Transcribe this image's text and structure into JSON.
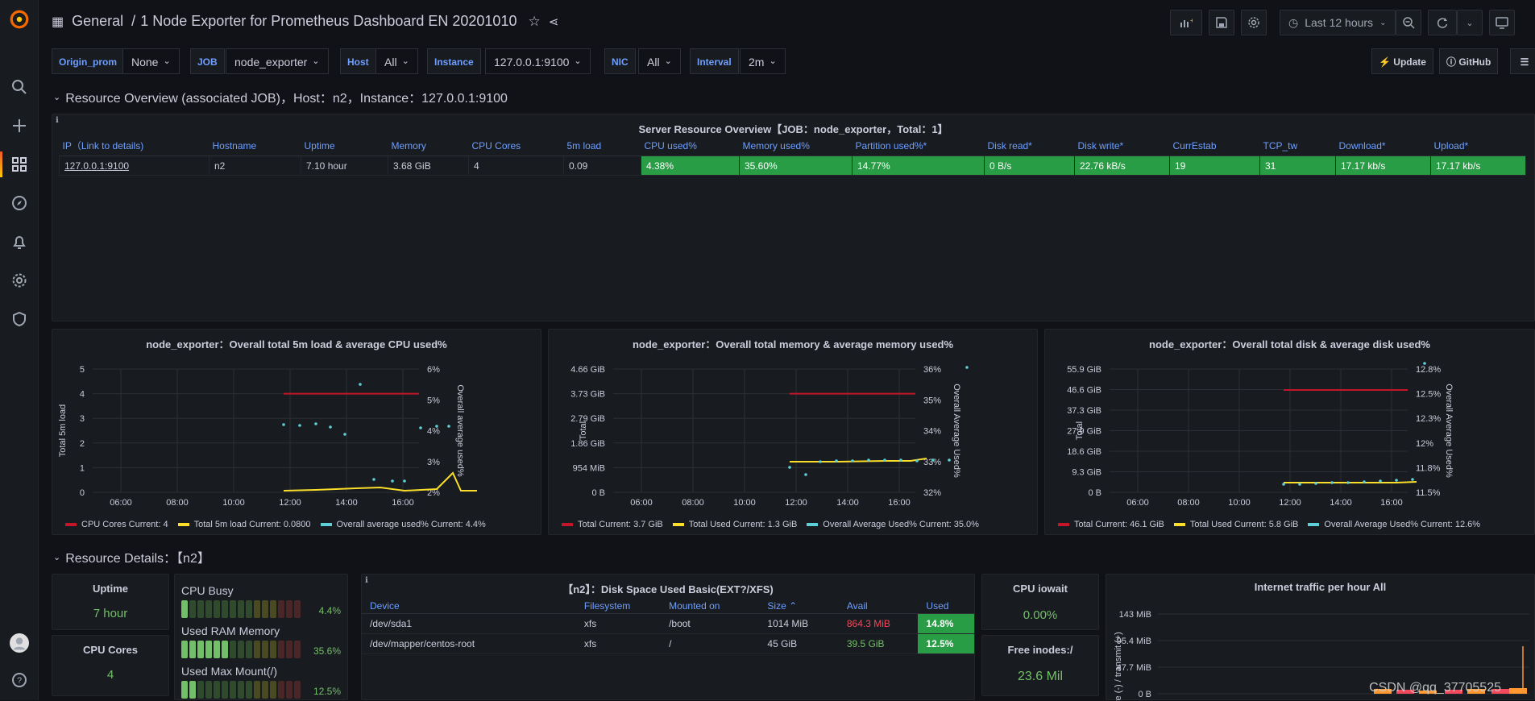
{
  "colors": {
    "accent": "#6e9fff",
    "green": "#73bf69",
    "cell_green": "#299c46",
    "red": "#c4162a",
    "yellow": "#fade2a",
    "cyan": "#5ecfd6",
    "orange_red": "#f2495c"
  },
  "header": {
    "folder": "General",
    "separator": "/",
    "title": "1 Node Exporter for Prometheus Dashboard EN 20201010",
    "time_range": "Last 12 hours"
  },
  "variables": [
    {
      "label": "Origin_prom",
      "value": "None"
    },
    {
      "label": "JOB",
      "value": "node_exporter"
    },
    {
      "label": "Host",
      "value": "All"
    },
    {
      "label": "Instance",
      "value": "127.0.0.1:9100"
    },
    {
      "label": "NIC",
      "value": "All"
    },
    {
      "label": "Interval",
      "value": "2m"
    }
  ],
  "links": {
    "update": "Update",
    "github": "GitHub"
  },
  "row1": {
    "title": "Resource Overview (associated JOB)，Host：n2，Instance：127.0.0.1:9100"
  },
  "overview": {
    "title": "Server Resource Overview【JOB：node_exporter，Total：1】",
    "columns": [
      "IP（Link to details)",
      "Hostname",
      "Uptime",
      "Memory",
      "CPU Cores",
      "5m load",
      "CPU used%",
      "Memory used%",
      "Partition used%*",
      "Disk read*",
      "Disk write*",
      "CurrEstab",
      "TCP_tw",
      "Download*",
      "Upload*"
    ],
    "row": [
      "127.0.0.1:9100",
      "n2",
      "7.10 hour",
      "3.68 GiB",
      "4",
      "0.09",
      "4.38%",
      "35.60%",
      "14.77%",
      "0 B/s",
      "22.76 kB/s",
      "19",
      "31",
      "17.17 kb/s",
      "17.17 kb/s"
    ]
  },
  "charts": [
    {
      "title": "node_exporter：Overall total 5m load & average CPU used%",
      "ylabel": "Total 5m load",
      "y2label": "Overall average used%",
      "yticks": [
        "5",
        "4",
        "3",
        "2",
        "1",
        "0"
      ],
      "y2ticks": [
        "6%",
        "5%",
        "4%",
        "3%",
        "2%"
      ],
      "legend": [
        "CPU Cores  Current: 4",
        "Total 5m load  Current: 0.0800",
        "Overall average used%  Current: 4.4%"
      ]
    },
    {
      "title": "node_exporter：Overall total memory & average memory used%",
      "ylabel": "Total",
      "y2label": "Overall Average Used%",
      "yticks": [
        "4.66 GiB",
        "3.73 GiB",
        "2.79 GiB",
        "1.86 GiB",
        "954 MiB",
        "0 B"
      ],
      "y2ticks": [
        "36%",
        "35%",
        "34%",
        "33%",
        "32%"
      ],
      "legend": [
        "Total  Current: 3.7 GiB",
        "Total Used  Current: 1.3 GiB",
        "Overall Average Used%  Current: 35.0%"
      ]
    },
    {
      "title": "node_exporter：Overall total disk & average disk used%",
      "ylabel": "Total",
      "y2label": "Overall Average Used%",
      "yticks": [
        "55.9 GiB",
        "46.6 GiB",
        "37.3 GiB",
        "27.9 GiB",
        "18.6 GiB",
        "9.3 GiB",
        "0 B"
      ],
      "y2ticks": [
        "12.8%",
        "12.5%",
        "12.3%",
        "12%",
        "11.8%",
        "11.5%"
      ],
      "legend": [
        "Total  Current: 46.1 GiB",
        "Total Used  Current: 5.8 GiB",
        "Overall Average Used%  Current: 12.6%"
      ]
    }
  ],
  "xticks": [
    "06:00",
    "08:00",
    "10:00",
    "12:00",
    "14:00",
    "16:00"
  ],
  "row2": {
    "title": "Resource Details：【n2】"
  },
  "stats": {
    "uptime_label": "Uptime",
    "uptime_value": "7 hour",
    "cores_label": "CPU Cores",
    "cores_value": "4",
    "iowait_label": "CPU iowait",
    "iowait_value": "0.00%",
    "inodes_label": "Free inodes:/",
    "inodes_value": "23.6 Mil"
  },
  "gauges": [
    {
      "label": "CPU Busy",
      "value": "4.4%",
      "fraction": 0.044
    },
    {
      "label": "Used RAM Memory",
      "value": "35.6%",
      "fraction": 0.356
    },
    {
      "label": "Used Max Mount(/)",
      "value": "12.5%",
      "fraction": 0.125
    }
  ],
  "disk": {
    "title": "【n2】：Disk Space Used Basic(EXT?/XFS)",
    "columns": [
      "Device",
      "Filesystem",
      "Mounted on",
      "Size ⌃",
      "Avail",
      "Used"
    ],
    "rows": [
      [
        "/dev/sda1",
        "xfs",
        "/boot",
        "1014 MiB",
        "864.3 MiB",
        "14.8%"
      ],
      [
        "/dev/mapper/centos-root",
        "xfs",
        "/",
        "45 GiB",
        "39.5 GiB",
        "12.5%"
      ]
    ]
  },
  "traffic": {
    "title": "Internet traffic per hour All",
    "yticks": [
      "143 MiB",
      "95.4 MiB",
      "47.7 MiB",
      "0 B"
    ],
    "ylabel": "receive (-) / transmit (+)"
  },
  "watermark": "CSDN @qq_37705525"
}
